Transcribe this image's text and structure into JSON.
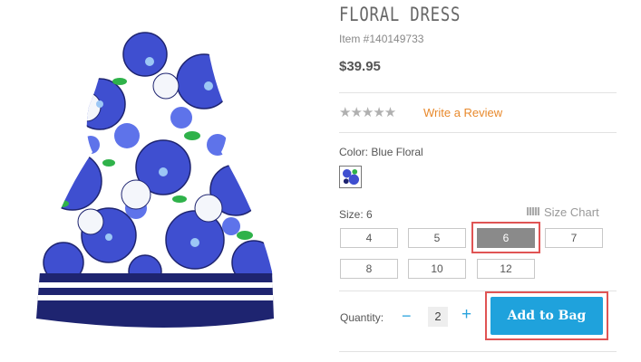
{
  "product": {
    "title": "FLORAL DRESS",
    "item_number": "Item #140149733",
    "price": "$39.95"
  },
  "reviews": {
    "stars": "★★★★★",
    "rating": 0,
    "write_review_label": "Write a Review"
  },
  "color": {
    "label": "Color: Blue Floral",
    "selected": "Blue Floral"
  },
  "size": {
    "label": "Size: 6",
    "size_chart_label": "Size Chart",
    "options": [
      "4",
      "5",
      "6",
      "7",
      "8",
      "10",
      "12"
    ],
    "selected": "6"
  },
  "quantity": {
    "label": "Quantity:",
    "value": "2",
    "minus": "−",
    "plus": "+"
  },
  "add_to_bag_label": "Add to Bag",
  "colors": {
    "accent_blue": "#1fa2dc",
    "review_orange": "#e8892c",
    "highlight_red": "#e05454",
    "dress_navy": "#1e2470",
    "dress_blue": "#3f4fd0"
  }
}
